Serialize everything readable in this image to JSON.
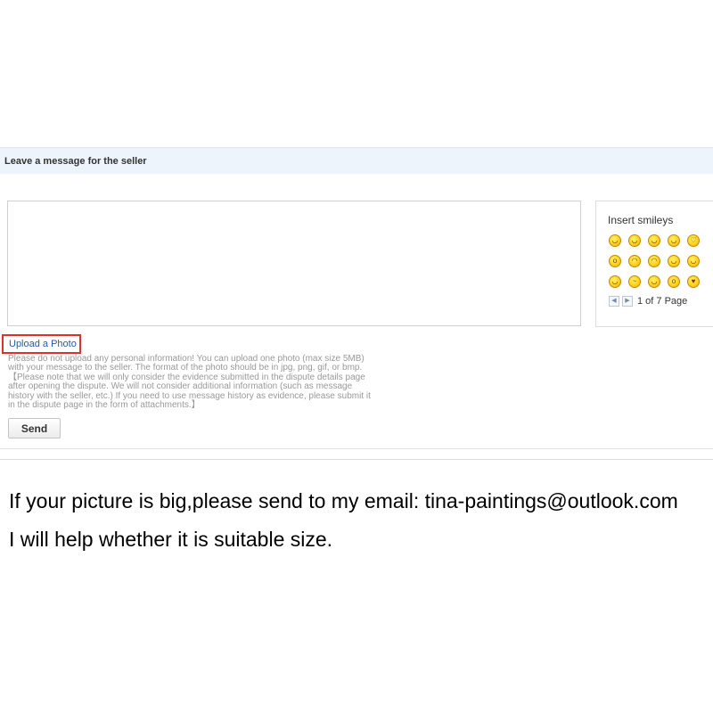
{
  "header": {
    "title": "Leave a message for the seller"
  },
  "message": {
    "value": "",
    "placeholder": ""
  },
  "smileys": {
    "title": "Insert smileys",
    "items": [
      {
        "icon": "smiley-happy-icon",
        "glyph": "◡"
      },
      {
        "icon": "smiley-laugh-icon",
        "glyph": "◡"
      },
      {
        "icon": "smiley-wink-icon",
        "glyph": "◡"
      },
      {
        "icon": "smiley-shy-icon",
        "glyph": "◡"
      },
      {
        "icon": "smiley-kiss-icon",
        "glyph": "♡"
      },
      {
        "icon": "smiley-shout-icon",
        "glyph": "o"
      },
      {
        "icon": "smiley-angry-icon",
        "glyph": "◠"
      },
      {
        "icon": "smiley-cry-icon",
        "glyph": "◠"
      },
      {
        "icon": "smiley-cheer-icon",
        "glyph": "◡"
      },
      {
        "icon": "smiley-hug-icon",
        "glyph": "◡"
      },
      {
        "icon": "smiley-tongue-icon",
        "glyph": "◡"
      },
      {
        "icon": "smiley-think-icon",
        "glyph": "~"
      },
      {
        "icon": "smiley-sweat-icon",
        "glyph": "◡"
      },
      {
        "icon": "smiley-surprise-icon",
        "glyph": "o"
      },
      {
        "icon": "smiley-love-icon",
        "glyph": "♥"
      }
    ],
    "pager": {
      "prev": "◀",
      "next": "▶",
      "label": "1 of 7 Page"
    }
  },
  "upload": {
    "label": "Upload a Photo"
  },
  "notice": {
    "lines": [
      "Please do not upload any personal information! You can upload one photo (max size 5MB)",
      "with your message to the seller. The format of the photo should be in jpg, png, gif, or bmp.",
      "【Please note that we will only consider the evidence submitted in the dispute details page",
      "after opening the dispute. We will not consider additional information (such as message",
      "history with the seller, etc.) If you need to use message history as evidence, please submit it",
      "in the dispute page in the form of attachments.】"
    ]
  },
  "send": {
    "label": "Send"
  },
  "footer": {
    "line1": "If your picture is big,please send to my email: tina-paintings@outlook.com",
    "line2": "I will help whether it is suitable size."
  },
  "colors": {
    "header_bg": "#eef4fb",
    "link": "#1a5fb4",
    "highlight_border": "#e0302a"
  }
}
